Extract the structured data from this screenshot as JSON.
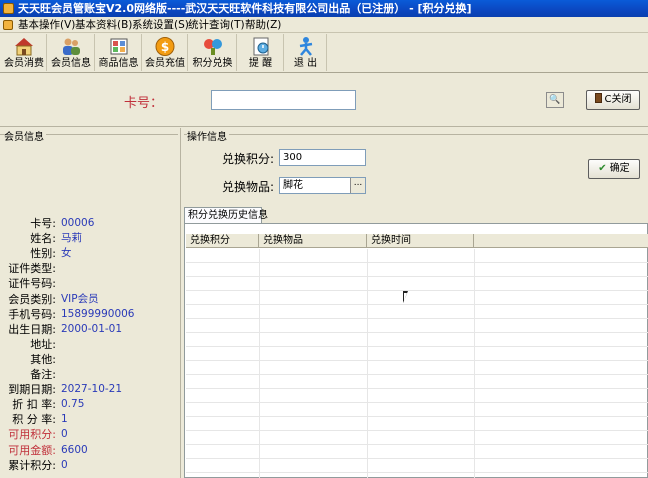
{
  "window": {
    "title": "天天旺会员管账宝V2.0网络版----武汉天天旺软件科技有限公司出品（已注册） - [积分兑换]"
  },
  "menu": [
    {
      "label": "基本操作(V)"
    },
    {
      "label": "基本资料(B)"
    },
    {
      "label": "系统设置(S)"
    },
    {
      "label": "统计查询(T)"
    },
    {
      "label": "帮助(Z)"
    }
  ],
  "toolbar": [
    {
      "label": "会员消费",
      "icon": "house-icon"
    },
    {
      "label": "会员信息",
      "icon": "users-icon"
    },
    {
      "label": "商品信息",
      "icon": "grid-icon"
    },
    {
      "label": "会员充值",
      "icon": "coin-icon"
    },
    {
      "label": "积分兑换",
      "icon": "exchange-icon"
    },
    {
      "label": "提 醒",
      "icon": "reminder-icon"
    },
    {
      "label": "退 出",
      "icon": "exit-icon"
    }
  ],
  "card": {
    "label": "卡号：",
    "value": "",
    "search_glyph": "🔍",
    "close_label": "C关闭"
  },
  "member_panel": {
    "title": "会员信息",
    "rows": [
      {
        "key": "卡号:",
        "value": "00006",
        "style": "blue"
      },
      {
        "key": "姓名:",
        "value": "马莉",
        "style": "blue"
      },
      {
        "key": "性别:",
        "value": "女",
        "style": "blue"
      },
      {
        "key": "证件类型:",
        "value": "",
        "style": "blue"
      },
      {
        "key": "证件号码:",
        "value": "",
        "style": "blue"
      },
      {
        "key": "会员类别:",
        "value": "VIP会员",
        "style": "blue"
      },
      {
        "key": "手机号码:",
        "value": "15899990006",
        "style": "blue"
      },
      {
        "key": "出生日期:",
        "value": "2000-01-01",
        "style": "blue"
      },
      {
        "key": "地址:",
        "value": "",
        "style": "blue"
      },
      {
        "key": "其他:",
        "value": "",
        "style": "blue"
      },
      {
        "key": "备注:",
        "value": "",
        "style": "blue"
      },
      {
        "key": "到期日期:",
        "value": "2027-10-21",
        "style": "blue"
      },
      {
        "key": "折 扣 率:",
        "value": "0.75",
        "style": "blue"
      },
      {
        "key": "积 分 率:",
        "value": "1",
        "style": "blue"
      },
      {
        "key": "可用积分:",
        "value": "0",
        "style": "red"
      },
      {
        "key": "可用金额:",
        "value": "6600",
        "style": "red"
      },
      {
        "key": "累计积分:",
        "value": "0",
        "style": "blue"
      }
    ]
  },
  "operation": {
    "title": "操作信息",
    "points_label": "兑换积分:",
    "points_value": "300",
    "item_label": "兑换物品:",
    "item_value": "脚花",
    "item_dots": "...",
    "ok_label": "确定"
  },
  "history": {
    "tab_label": "积分兑换历史信息",
    "columns": [
      "兑换积分",
      "兑换物品",
      "兑换时间"
    ],
    "rows": []
  },
  "colors": {
    "title_blue": "#0A5BD8",
    "label_red": "#C0303A",
    "value_blue": "#2A3AB8",
    "window_bg": "#ECE9D8"
  }
}
